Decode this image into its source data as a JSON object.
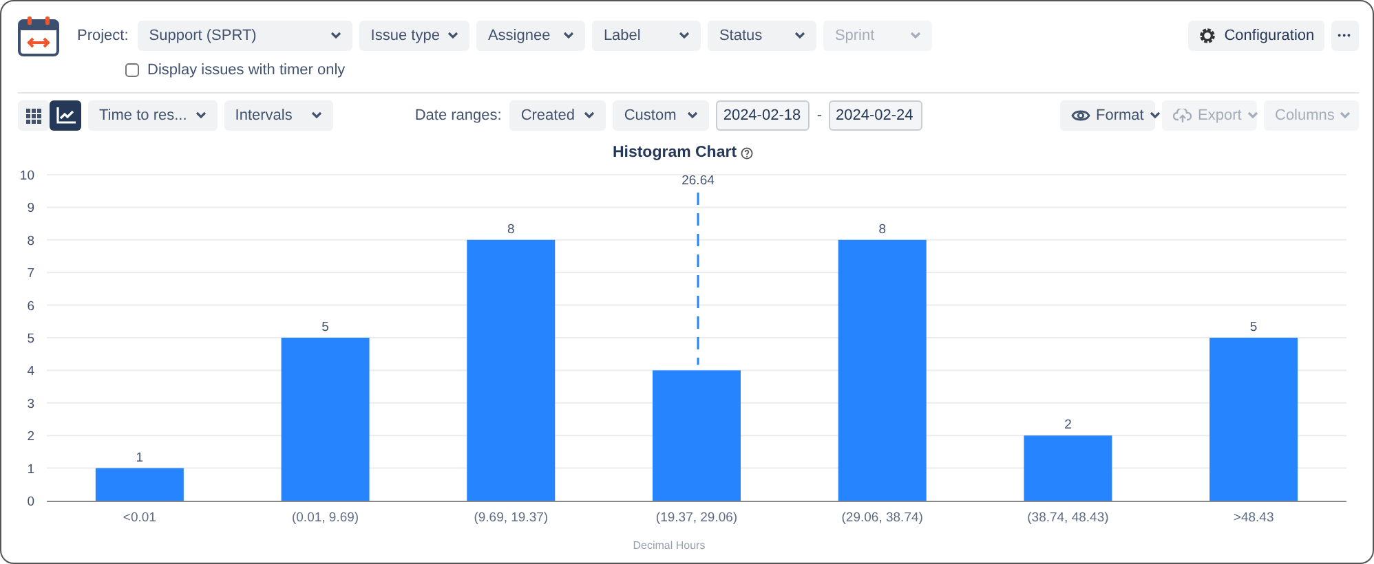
{
  "header": {
    "project_label": "Project:",
    "filters": [
      {
        "label": "Support (SPRT)",
        "disabled": false
      },
      {
        "label": "Issue type",
        "disabled": false
      },
      {
        "label": "Assignee",
        "disabled": false
      },
      {
        "label": "Label",
        "disabled": false
      },
      {
        "label": "Status",
        "disabled": false
      },
      {
        "label": "Sprint",
        "disabled": true
      }
    ],
    "configuration": "Configuration",
    "more": "•••",
    "timer_only": {
      "label": "Display issues with timer only",
      "checked": false
    }
  },
  "toolbar": {
    "views": [
      {
        "kind": "grid",
        "selected": false
      },
      {
        "kind": "chart",
        "selected": true
      }
    ],
    "left": [
      {
        "label": "Time to res...",
        "disabled": false
      },
      {
        "label": "Intervals",
        "disabled": false
      }
    ],
    "date_label": "Date ranges:",
    "date": [
      {
        "label": "Created",
        "disabled": false
      },
      {
        "label": "Custom",
        "disabled": false
      }
    ],
    "from": "2024-02-18",
    "separator": "-",
    "to": "2024-02-24",
    "right": [
      {
        "kind": "format",
        "label": "Format",
        "disabled": false
      },
      {
        "kind": "export",
        "label": "Export",
        "disabled": true
      },
      {
        "kind": "plain",
        "label": "Columns",
        "disabled": true
      }
    ]
  },
  "chart": {
    "chart_data": {
      "type": "bar",
      "title": "Histogram Chart",
      "xlabel": "Decimal Hours",
      "categories": [
        "<0.01",
        "(0.01, 9.69)",
        "(9.69, 19.37)",
        "(19.37, 29.06)",
        "(29.06, 38.74)",
        "(38.74, 48.43)",
        ">48.43"
      ],
      "series": [
        {
          "color": "#2684ff",
          "values": [
            1,
            5,
            8,
            4,
            8,
            2,
            5
          ]
        }
      ],
      "ylim": [
        0,
        10
      ],
      "yticks": [
        0,
        1,
        2,
        3,
        4,
        5,
        6,
        7,
        8,
        9,
        10
      ],
      "value_labels": [
        "1",
        "5",
        "8",
        null,
        "8",
        "2",
        "5"
      ],
      "grid": true,
      "annotations": [
        {
          "x": "(19.37, 29.06)",
          "text": "26.64"
        }
      ]
    }
  }
}
